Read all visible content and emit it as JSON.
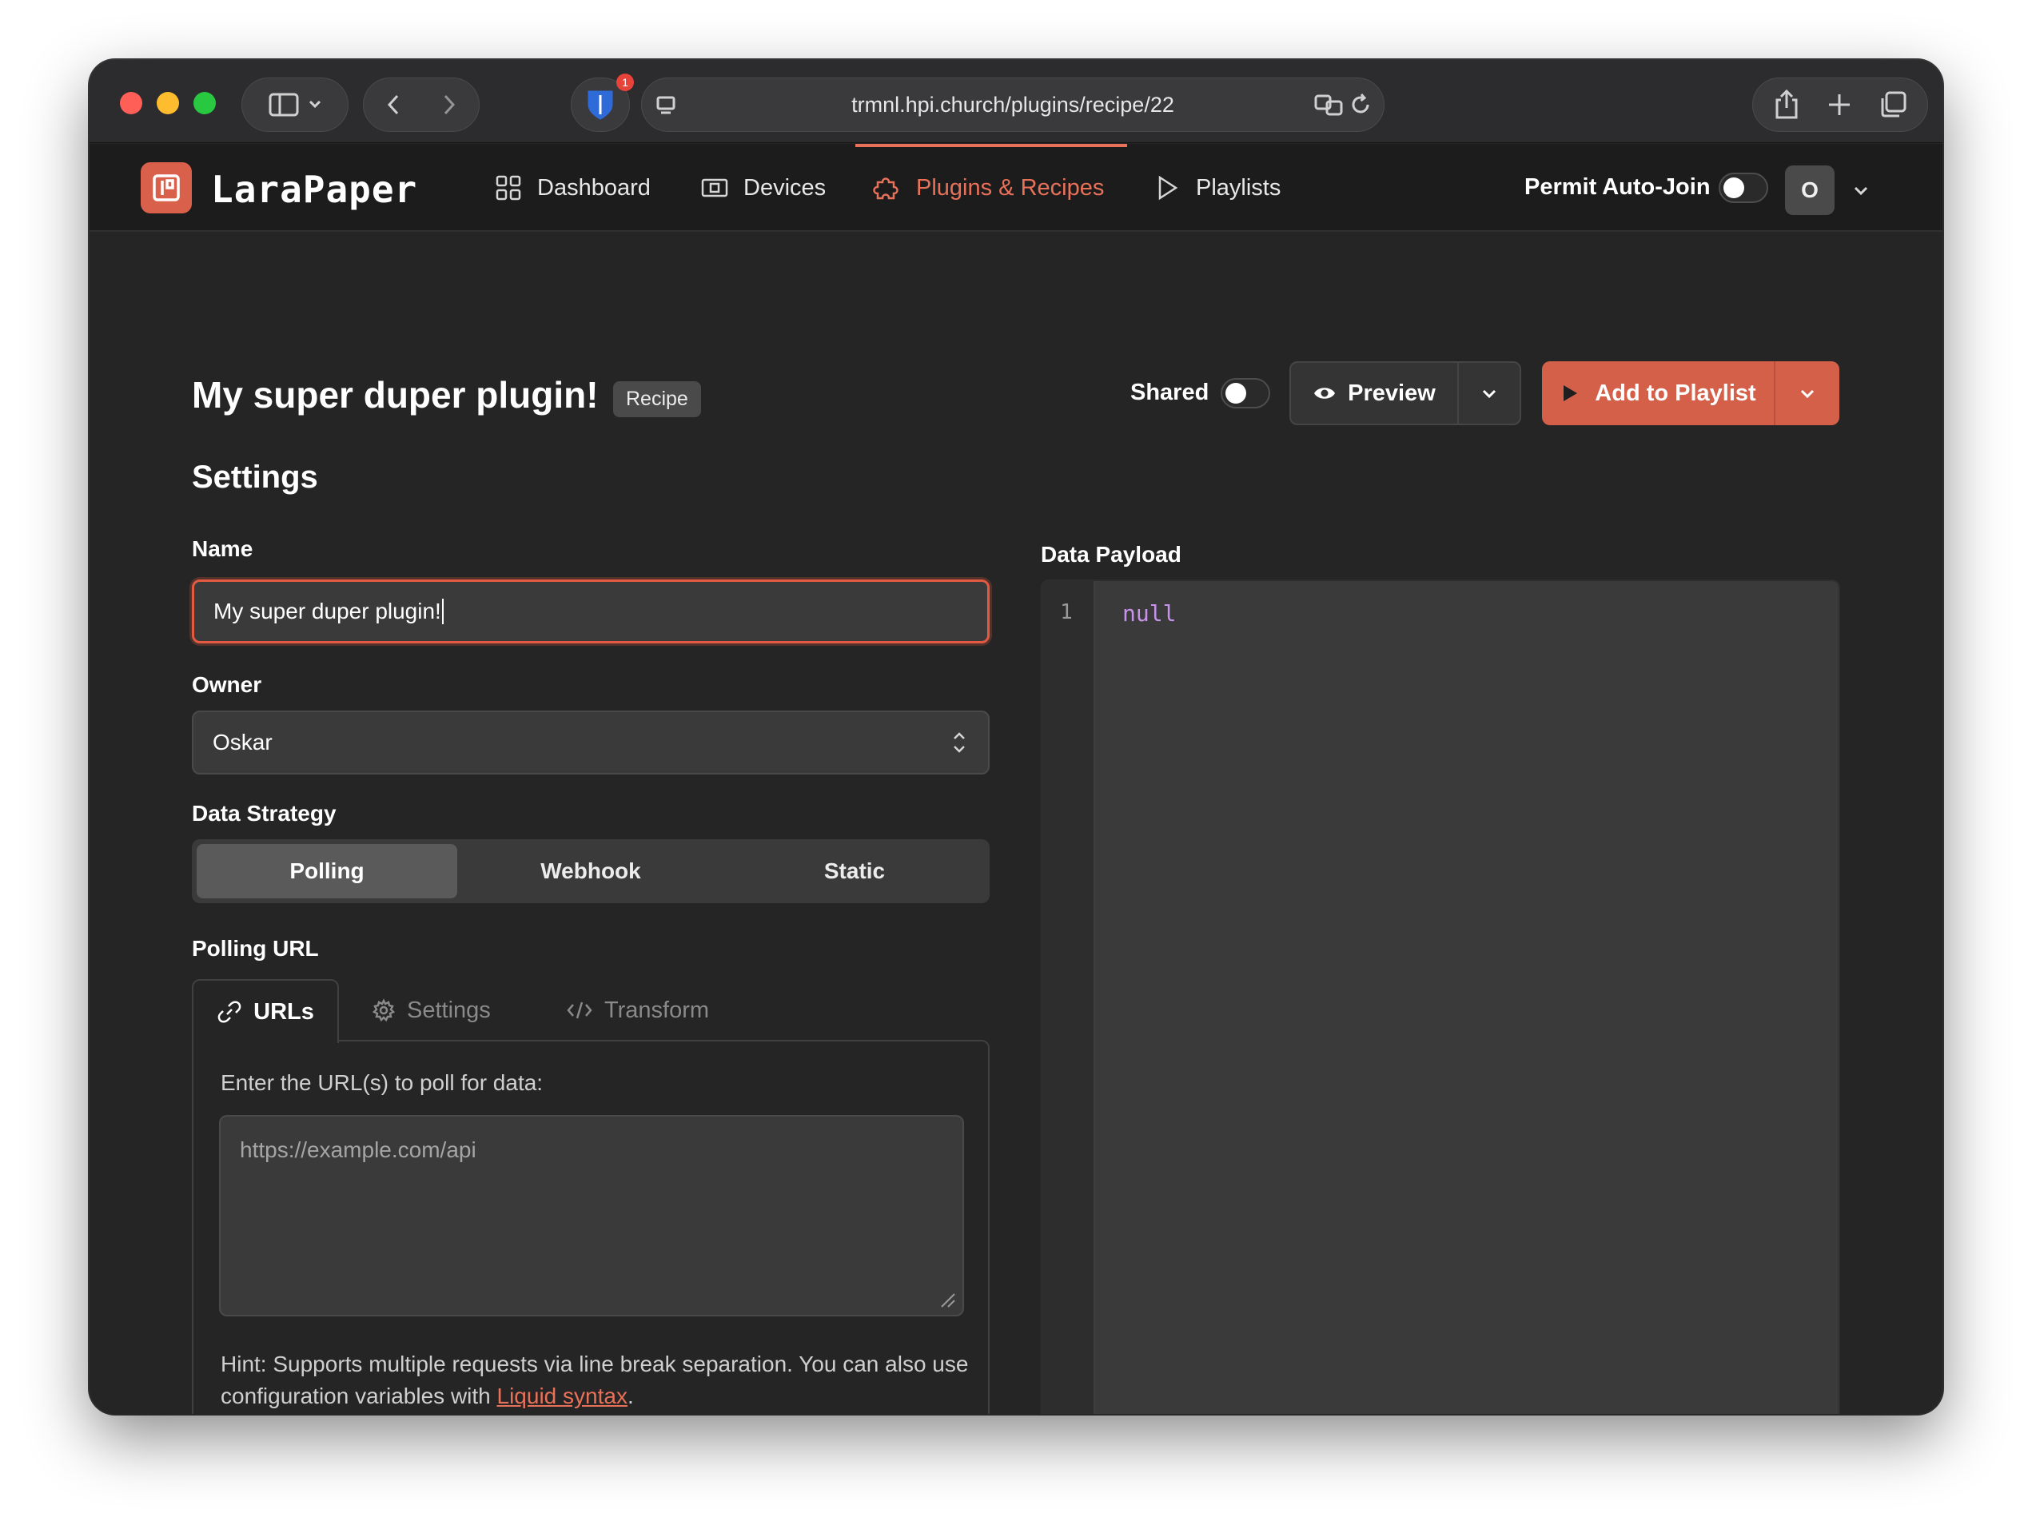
{
  "browser": {
    "url": "trmnl.hpi.church/plugins/recipe/22",
    "extension_badge": "1"
  },
  "app": {
    "logo_text": "LaraPaper",
    "nav": [
      {
        "label": "Dashboard",
        "icon": "grid-icon",
        "active": false
      },
      {
        "label": "Devices",
        "icon": "device-icon",
        "active": false
      },
      {
        "label": "Plugins & Recipes",
        "icon": "puzzle-icon",
        "active": true
      },
      {
        "label": "Playlists",
        "icon": "play-icon",
        "active": false
      }
    ],
    "permit_auto_join_label": "Permit Auto-Join",
    "permit_auto_join": false,
    "user_initial": "O"
  },
  "page": {
    "title": "My super duper plugin!",
    "badge": "Recipe",
    "shared_label": "Shared",
    "shared": false,
    "preview_label": "Preview",
    "add_to_playlist_label": "Add to Playlist",
    "accent_color": "#d4604a"
  },
  "settings": {
    "title": "Settings",
    "name_label": "Name",
    "name_value": "My super duper plugin!",
    "owner_label": "Owner",
    "owner_value": "Oskar",
    "strategy_label": "Data Strategy",
    "strategies": [
      "Polling",
      "Webhook",
      "Static"
    ],
    "strategy_selected": "Polling",
    "polling_url_label": "Polling URL",
    "tabs": [
      {
        "label": "URLs",
        "icon": "link-icon",
        "active": true
      },
      {
        "label": "Settings",
        "icon": "gear-icon",
        "active": false
      },
      {
        "label": "Transform",
        "icon": "code-icon",
        "active": false
      }
    ],
    "urls_prompt": "Enter the URL(s) to poll for data:",
    "urls_placeholder": "https://example.com/api",
    "hint_text": "Hint: Supports multiple requests via line break separation. You can also use configuration variables with ",
    "hint_link": "Liquid syntax",
    "hint_end": "."
  },
  "payload": {
    "label": "Data Payload",
    "line_number": "1",
    "code": "null"
  }
}
